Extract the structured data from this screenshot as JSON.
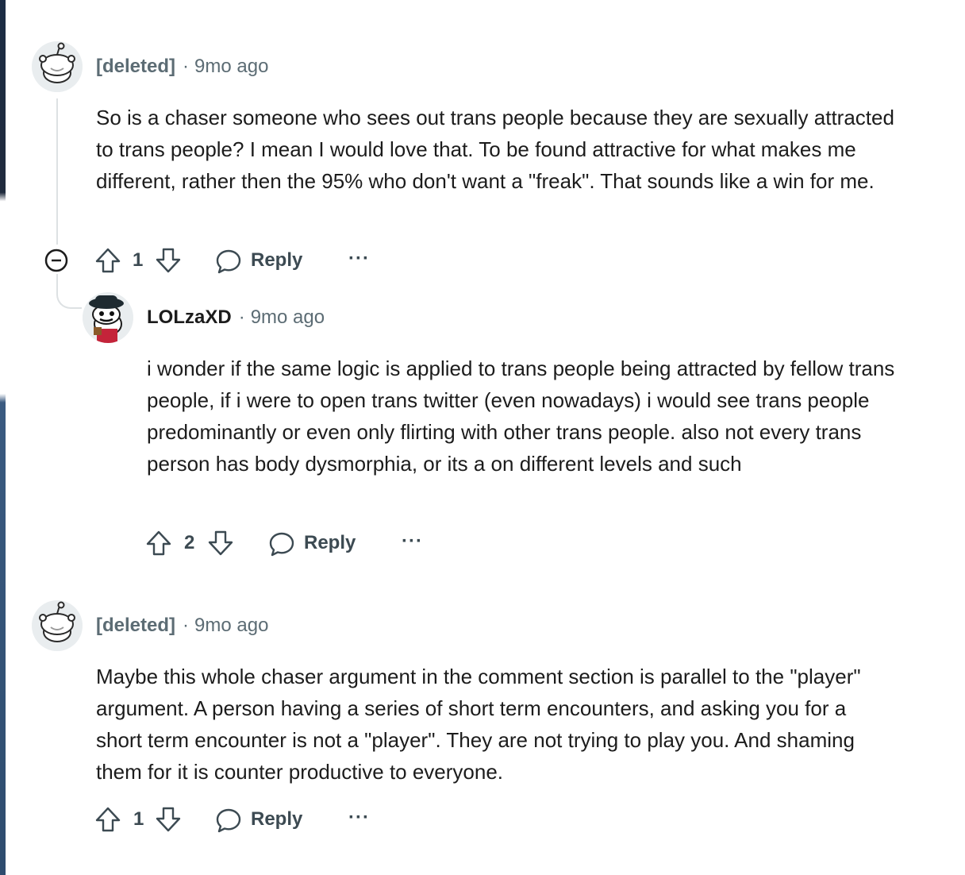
{
  "comments": [
    {
      "author": "[deleted]",
      "time": "9mo ago",
      "body": "So is a chaser someone who sees out trans people because they are sexually attracted to trans people? I mean I would love that. To be found attractive for what makes me different, rather then the 95% who don't want a \"freak\". That sounds like a win for me.",
      "score": "1",
      "reply_label": "Reply",
      "more_label": "···"
    },
    {
      "author": "LOLzaXD",
      "time": "9mo ago",
      "body": "i wonder if the same logic is applied to trans people being attracted by fellow trans people, if i were to open trans twitter (even nowadays) i would see trans people predominantly or even only flirting with other trans people. also not every trans person has body dysmorphia, or its a on different levels and such",
      "score": "2",
      "reply_label": "Reply",
      "more_label": "···"
    },
    {
      "author": "[deleted]",
      "time": "9mo ago",
      "body": "Maybe this whole chaser argument in the comment section is parallel to the \"player\" argument. A person having a series of short term encounters, and asking you for a short term encounter is not a \"player\". They are not trying to play you. And shaming them for it is counter productive to everyone.",
      "score": "1",
      "reply_label": "Reply",
      "more_label": "···"
    }
  ],
  "colors": {
    "text": "#1c1c1c",
    "meta": "#5c6c74",
    "thread": "#dde1e3",
    "action": "#3c4a52"
  },
  "icons": [
    "snoo-deleted-avatar",
    "user-avatar",
    "collapse-icon",
    "upvote-icon",
    "downvote-icon",
    "reply-icon"
  ]
}
